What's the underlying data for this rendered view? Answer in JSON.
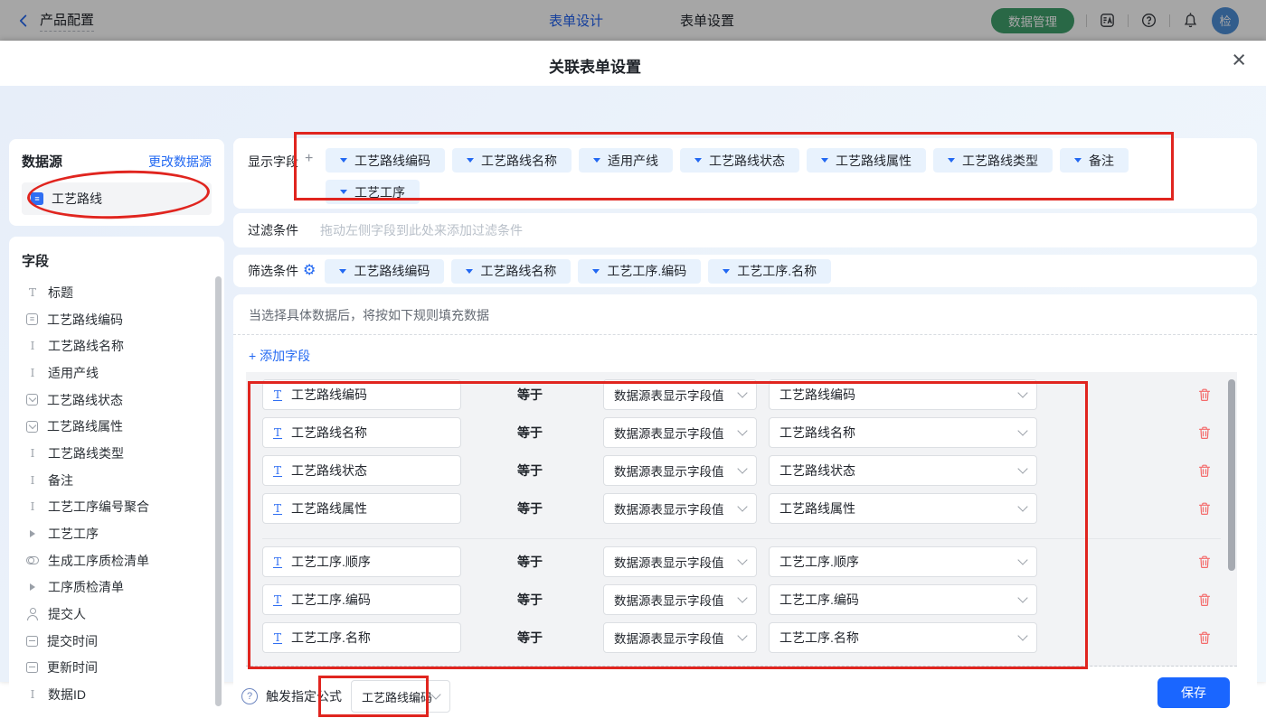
{
  "colors": {
    "accent": "#2268f2",
    "save_button": "#1a66ff",
    "data_manage_button": "#3fa06c",
    "annotation_red": "#e0251f",
    "avatar_blue": "#4e8fd8",
    "tag_background": "#e8f2fd"
  },
  "header": {
    "back_label": "产品配置",
    "tabs": [
      {
        "label": "表单设计",
        "active": true
      },
      {
        "label": "表单设置",
        "active": false
      }
    ],
    "data_manage_label": "数据管理",
    "icons": [
      "back-icon",
      "translate-icon",
      "help-icon",
      "bell-icon"
    ],
    "avatar_text": "检"
  },
  "modal": {
    "title": "关联表单设置",
    "close_icon": "close-icon"
  },
  "sidebar": {
    "datasource": {
      "title": "数据源",
      "change_link": "更改数据源",
      "item_label": "工艺路线",
      "item_icon": "document-icon"
    },
    "fields": {
      "title": "字段",
      "items": [
        {
          "label": "标题",
          "icon": "title-icon"
        },
        {
          "label": "工艺路线编码",
          "icon": "number-icon"
        },
        {
          "label": "工艺路线名称",
          "icon": "text-icon"
        },
        {
          "label": "适用产线",
          "icon": "text-icon"
        },
        {
          "label": "工艺路线状态",
          "icon": "select-icon"
        },
        {
          "label": "工艺路线属性",
          "icon": "select-icon"
        },
        {
          "label": "工艺路线类型",
          "icon": "text-icon"
        },
        {
          "label": "备注",
          "icon": "text-icon"
        },
        {
          "label": "工艺工序编号聚合",
          "icon": "text-icon"
        },
        {
          "label": "工艺工序",
          "icon": "expand-icon"
        },
        {
          "label": "生成工序质检清单",
          "icon": "toggle-icon"
        },
        {
          "label": "工序质检清单",
          "icon": "expand-icon"
        },
        {
          "label": "提交人",
          "icon": "person-icon"
        },
        {
          "label": "提交时间",
          "icon": "calendar-icon"
        },
        {
          "label": "更新时间",
          "icon": "calendar-icon"
        },
        {
          "label": "数据ID",
          "icon": "text-icon"
        }
      ]
    }
  },
  "display_fields": {
    "label": "显示字段",
    "tags": [
      "工艺路线编码",
      "工艺路线名称",
      "适用产线",
      "工艺路线状态",
      "工艺路线属性",
      "工艺路线类型",
      "备注",
      "工艺工序"
    ]
  },
  "filter": {
    "label": "过滤条件",
    "placeholder": "拖动左侧字段到此处来添加过滤条件"
  },
  "screening": {
    "label": "筛选条件",
    "tags": [
      "工艺路线编码",
      "工艺路线名称",
      "工艺工序.编码",
      "工艺工序.名称"
    ]
  },
  "rules": {
    "note": "当选择具体数据后，将按如下规则填充数据",
    "add_field_label": "+ 添加字段",
    "operator": "等于",
    "source_value": "数据源表显示字段值",
    "group1": [
      {
        "field": "工艺路线编码",
        "target": "工艺路线编码"
      },
      {
        "field": "工艺路线名称",
        "target": "工艺路线名称"
      },
      {
        "field": "工艺路线状态",
        "target": "工艺路线状态"
      },
      {
        "field": "工艺路线属性",
        "target": "工艺路线属性"
      }
    ],
    "group2": [
      {
        "field": "工艺工序.顺序",
        "target": "工艺工序.顺序"
      },
      {
        "field": "工艺工序.编码",
        "target": "工艺工序.编码"
      },
      {
        "field": "工艺工序.名称",
        "target": "工艺工序.名称"
      }
    ]
  },
  "trigger": {
    "label": "触发指定公式",
    "value": "工艺路线编码"
  },
  "footer": {
    "save_label": "保存"
  }
}
